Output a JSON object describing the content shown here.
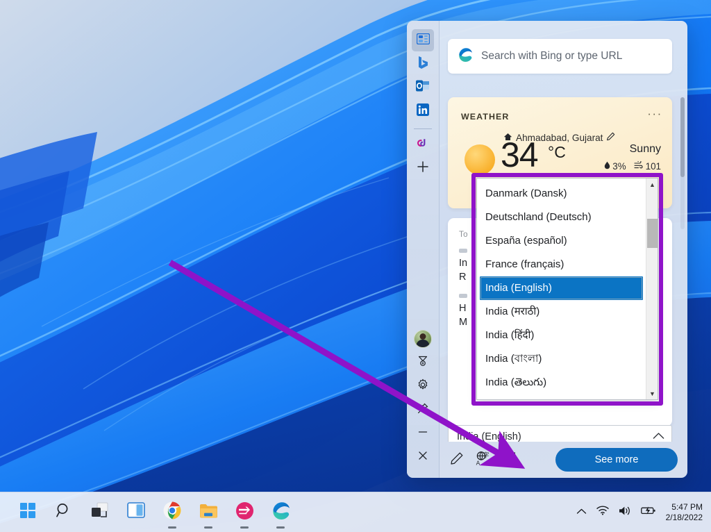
{
  "desktop": {
    "wallpaper_name": "windows-11-bloom-wallpaper"
  },
  "widgets_panel": {
    "rail": {
      "items": [
        {
          "name": "widgets-board",
          "icon": "widgets-board-icon",
          "active": true
        },
        {
          "name": "bing",
          "icon": "bing-icon",
          "active": false
        },
        {
          "name": "outlook",
          "icon": "outlook-icon",
          "active": false
        },
        {
          "name": "linkedin",
          "icon": "linkedin-icon",
          "active": false
        },
        {
          "name": "office",
          "icon": "office-start-icon",
          "active": false
        },
        {
          "name": "add",
          "icon": "plus-icon",
          "active": false
        }
      ],
      "bottom_items": [
        {
          "name": "account-avatar",
          "icon": "avatar-icon"
        },
        {
          "name": "rewards",
          "icon": "rewards-medal-icon"
        },
        {
          "name": "settings",
          "icon": "gear-icon"
        },
        {
          "name": "pin",
          "icon": "pin-icon"
        },
        {
          "name": "minimize",
          "icon": "minimize-icon"
        },
        {
          "name": "close",
          "icon": "close-icon"
        }
      ]
    },
    "search": {
      "placeholder": "Search with Bing or type URL",
      "value": "",
      "icon": "edge-icon"
    },
    "weather": {
      "label": "WEATHER",
      "more_glyph": "···",
      "location": "Ahmadabad, Gujarat",
      "home_icon": "home-icon",
      "edit_icon": "pencil-icon",
      "temperature": "34",
      "unit": "°C",
      "condition": "Sunny",
      "precipitation": "3%",
      "precip_icon": "raindrop-icon",
      "air_quality": "101",
      "aqi_icon": "air-quality-icon"
    },
    "news_card": {
      "kicker_1": "To",
      "line_1": "In",
      "line_2": "R",
      "kicker_2": "H",
      "line_3": "M"
    },
    "language_combo": {
      "value": "India (English)",
      "chevron": "chevron-up-icon",
      "expanded": true
    },
    "toolbar": {
      "edit_icon": "pencil-icon",
      "language_icon": "language-icon",
      "refresh_icon": "refresh-icon",
      "see_more_label": "See more"
    }
  },
  "dropdown": {
    "scroll_up_glyph": "▲",
    "scroll_down_glyph": "▼",
    "selected_index": 4,
    "items": [
      "Danmark (Dansk)",
      "Deutschland (Deutsch)",
      "España (español)",
      "France (français)",
      "India (English)",
      "India (मराठी)",
      "India (हिंदी)",
      "India (বাংলা)",
      "India (తెలుగు)"
    ]
  },
  "annotation": {
    "highlight_color": "#8f13c9",
    "arrow_color": "#8f13c9",
    "arrow_from": "245,378",
    "arrow_to": "733,664"
  },
  "taskbar": {
    "apps": [
      {
        "name": "start",
        "icon": "windows-start-icon",
        "running": false
      },
      {
        "name": "search",
        "icon": "search-icon",
        "running": false
      },
      {
        "name": "task-view",
        "icon": "task-view-icon",
        "running": false
      },
      {
        "name": "widgets",
        "icon": "widgets-icon",
        "running": false
      },
      {
        "name": "chrome",
        "icon": "chrome-icon",
        "running": true
      },
      {
        "name": "file-explorer",
        "icon": "folder-icon",
        "running": true
      },
      {
        "name": "app-pink",
        "icon": "pink-app-icon",
        "running": true
      },
      {
        "name": "edge",
        "icon": "edge-icon",
        "running": true
      }
    ],
    "tray": {
      "chevron_icon": "chevron-up-icon",
      "wifi_icon": "wifi-icon",
      "volume_icon": "volume-icon",
      "battery_icon": "battery-charging-icon"
    },
    "clock": {
      "time": "5:47 PM",
      "date": "2/18/2022"
    }
  },
  "colors": {
    "accent_blue": "#0f6cbd",
    "selection_blue": "#0b74c4",
    "annotation_purple": "#8f13c9",
    "weather_card": "#fdf6e3"
  }
}
